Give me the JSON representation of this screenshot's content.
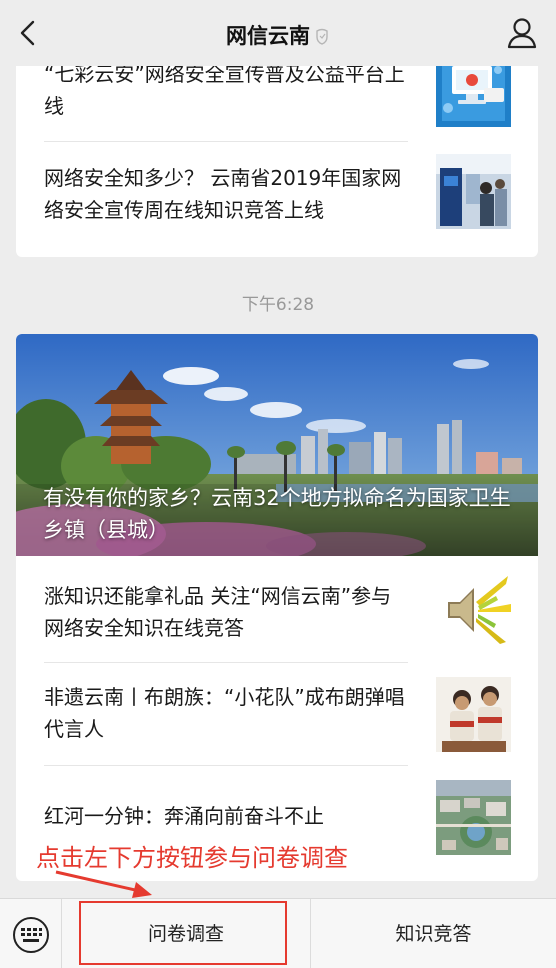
{
  "navbar": {
    "title": "网信云南"
  },
  "card1": {
    "items": [
      {
        "title": "“七彩云安”网络安全宣传普及公益平台上线",
        "thumb_icon": "monitor-laptop-illustration"
      },
      {
        "title": "网络安全知多少？ 云南省2019年国家网络安全宣传周在线知识竞答上线",
        "thumb_icon": "exhibition-photo"
      }
    ]
  },
  "timestamp": "下午6:28",
  "card2": {
    "hero_title": "有没有你的家乡？云南32个地方拟命名为国家卫生乡镇（县城）",
    "items": [
      {
        "title": "涨知识还能拿礼品 关注“网信云南”参与网络安全知识在线竞答",
        "thumb_icon": "speaker-icon"
      },
      {
        "title": "非遗云南丨布朗族：“小花队”成布朗弹唱代言人",
        "thumb_icon": "performers-photo"
      },
      {
        "title": "红河一分钟：奔涌向前奋斗不止",
        "thumb_icon": "aerial-city-photo"
      }
    ]
  },
  "annotation": {
    "text": "点击左下方按钮参与问卷调查",
    "color": "#e53a2f"
  },
  "bottom_menu": {
    "menu1": "问卷调查",
    "menu2": "知识竞答"
  }
}
